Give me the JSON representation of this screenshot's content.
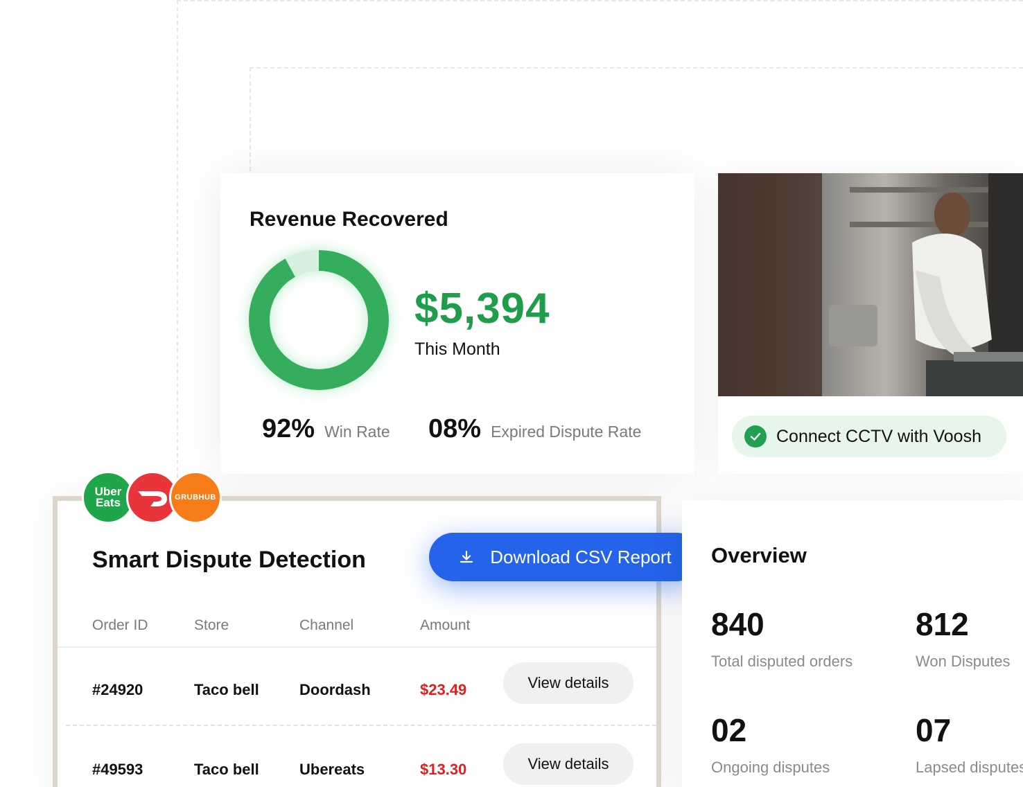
{
  "revenue": {
    "title": "Revenue Recovered",
    "amount": "$5,394",
    "period": "This Month",
    "win_rate_value": "92%",
    "win_rate_label": "Win Rate",
    "expired_value": "08%",
    "expired_label": "Expired Dispute Rate",
    "donut_fill_fraction": 0.92,
    "accent_color": "#1f9d4a"
  },
  "cctv": {
    "button_label": "Connect CCTV with Voosh",
    "check_icon": "check-circle-icon"
  },
  "platforms": {
    "uber_line1": "Uber",
    "uber_line2": "Eats",
    "grubhub": "GRUBHUB",
    "doordash_icon": "doordash-logo"
  },
  "disputes": {
    "title": "Smart Dispute Detection",
    "download_label": "Download CSV Report",
    "columns": [
      "Order ID",
      "Store",
      "Channel",
      "Amount"
    ],
    "rows": [
      {
        "order_id": "#24920",
        "store": "Taco bell",
        "channel": "Doordash",
        "amount": "$23.49",
        "action": "View details"
      },
      {
        "order_id": "#49593",
        "store": "Taco bell",
        "channel": "Ubereats",
        "amount": "$13.30",
        "action": "View details"
      }
    ],
    "amount_color": "#e0201f",
    "button_color": "#2563eb"
  },
  "overview": {
    "title": "Overview",
    "stats": [
      {
        "value": "840",
        "label": "Total disputed orders"
      },
      {
        "value": "812",
        "label": "Won Disputes"
      },
      {
        "value": "02",
        "label": "Ongoing disputes"
      },
      {
        "value": "07",
        "label": "Lapsed disputes"
      }
    ]
  }
}
